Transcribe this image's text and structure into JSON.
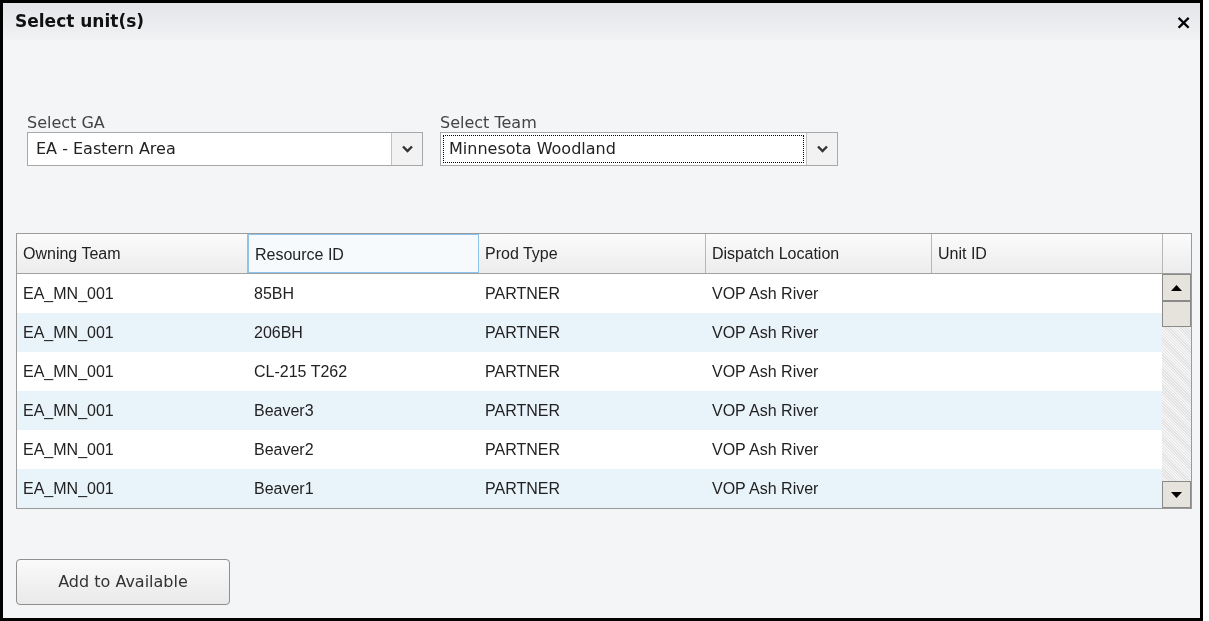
{
  "window": {
    "title": "Select unit(s)",
    "close": "×"
  },
  "selects": [
    {
      "label": "Select GA",
      "value": "EA - Eastern Area",
      "focused": false
    },
    {
      "label": "Select Team",
      "value": "Minnesota Woodland",
      "focused": true
    }
  ],
  "table": {
    "columns": [
      {
        "label": "Owning Team",
        "selected": false
      },
      {
        "label": "Resource ID",
        "selected": true
      },
      {
        "label": "Prod Type",
        "selected": false
      },
      {
        "label": "Dispatch Location",
        "selected": false
      },
      {
        "label": "Unit ID",
        "selected": false
      }
    ],
    "rows": [
      [
        "EA_MN_001",
        "85BH",
        "PARTNER",
        "VOP Ash River"
      ],
      [
        "EA_MN_001",
        "206BH",
        "PARTNER",
        "VOP Ash River"
      ],
      [
        "EA_MN_001",
        "CL-215 T262",
        "PARTNER",
        "VOP Ash River"
      ],
      [
        "EA_MN_001",
        "Beaver3",
        "PARTNER",
        "VOP Ash River"
      ],
      [
        "EA_MN_001",
        "Beaver2",
        "PARTNER",
        "VOP Ash River"
      ],
      [
        "EA_MN_001",
        "Beaver1",
        "PARTNER",
        "VOP Ash River"
      ]
    ]
  },
  "buttons": [
    "Add to Available"
  ]
}
